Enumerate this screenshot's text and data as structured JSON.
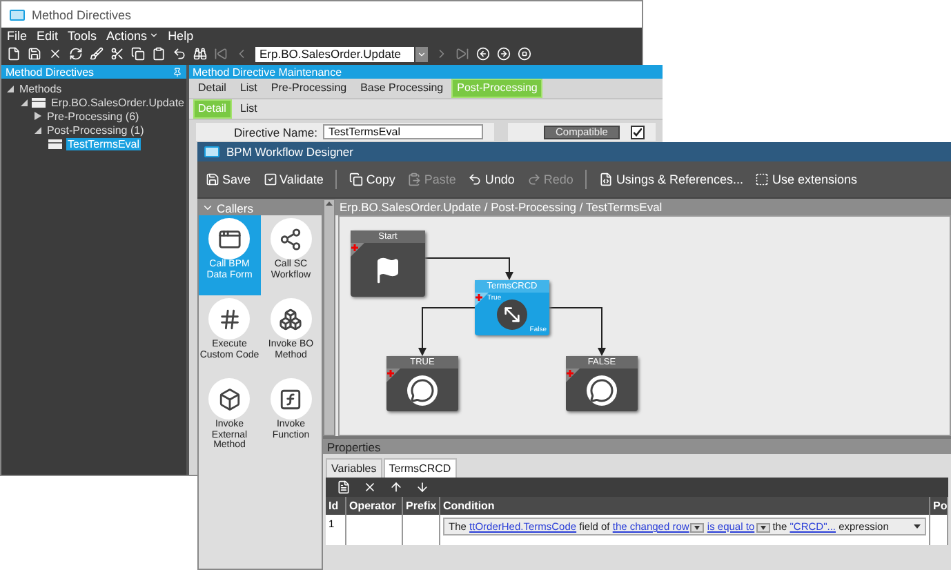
{
  "back_window": {
    "title": "Method Directives",
    "menu": [
      {
        "label": "File",
        "dropdown": false
      },
      {
        "label": "Edit",
        "dropdown": false
      },
      {
        "label": "Tools",
        "dropdown": false
      },
      {
        "label": "Actions",
        "dropdown": true
      },
      {
        "label": "Help",
        "dropdown": false
      }
    ],
    "combo_value": "Erp.BO.SalesOrder.Update",
    "left_panel": {
      "title": "Method Directives",
      "tree": [
        {
          "label": "Methods",
          "expanded": true,
          "selected": false,
          "children": [
            {
              "label": "Erp.BO.SalesOrder.Update",
              "kind": "method",
              "expanded": true,
              "selected": false,
              "children": [
                {
                  "label": "Pre-Processing (6)",
                  "expanded": false,
                  "selected": false
                },
                {
                  "label": "Post-Processing (1)",
                  "expanded": true,
                  "selected": false,
                  "children": [
                    {
                      "label": "TestTermsEval",
                      "kind": "directive",
                      "selected": true
                    }
                  ]
                }
              ]
            }
          ]
        }
      ]
    },
    "main_panel": {
      "title": "Method Directive Maintenance",
      "tabs": [
        {
          "label": "Detail",
          "selected": false
        },
        {
          "label": "List",
          "selected": false
        },
        {
          "label": "Pre-Processing",
          "selected": false
        },
        {
          "label": "Base Processing",
          "selected": false
        },
        {
          "label": "Post-Processing",
          "selected": true
        }
      ],
      "subtabs": [
        {
          "label": "Detail",
          "selected": true
        },
        {
          "label": "List",
          "selected": false
        }
      ],
      "directive_name_label": "Directive Name:",
      "directive_name": "TestTermsEval",
      "compatible_button": "Compatible",
      "compatible_checked": true
    }
  },
  "front_window": {
    "title": "BPM Workflow Designer",
    "toolbar": [
      {
        "label": "Save",
        "disabled": false
      },
      {
        "label": "Validate",
        "disabled": false
      },
      {
        "label": "Copy",
        "disabled": false
      },
      {
        "label": "Paste",
        "disabled": true
      },
      {
        "label": "Undo",
        "disabled": false
      },
      {
        "label": "Redo",
        "disabled": true
      },
      {
        "label": "Usings & References...",
        "disabled": false
      },
      {
        "label": "Use extensions",
        "disabled": false
      }
    ],
    "palette": {
      "title": "Callers",
      "items": [
        {
          "label": "Call BPM Data Form",
          "selected": true
        },
        {
          "label": "Call SC Workflow",
          "selected": false
        },
        {
          "label": "Execute Custom Code",
          "selected": false
        },
        {
          "label": "Invoke BO Method",
          "selected": false
        },
        {
          "label": "Invoke External Method",
          "selected": false
        },
        {
          "label": "Invoke Function",
          "selected": false
        }
      ]
    },
    "breadcrumb": "Erp.BO.SalesOrder.Update / Post-Processing / TestTermsEval",
    "nodes": [
      {
        "kind": "start",
        "title": "Start",
        "selected": false
      },
      {
        "kind": "condition",
        "title": "TermsCRCD",
        "selected": true,
        "true_label": "True",
        "false_label": "False"
      },
      {
        "kind": "message",
        "title": "TRUE",
        "selected": false
      },
      {
        "kind": "message",
        "title": "FALSE",
        "selected": false
      }
    ],
    "properties": {
      "title": "Properties",
      "tabs": [
        {
          "label": "Variables",
          "selected": false
        },
        {
          "label": "TermsCRCD",
          "selected": true
        }
      ],
      "columns": [
        "Id",
        "Operator",
        "Prefix",
        "Condition",
        "Po"
      ],
      "rows": [
        {
          "id": "1",
          "condition": [
            {
              "kind": "text",
              "text": "The"
            },
            {
              "kind": "link",
              "text": "ttOrderHed.TermsCode",
              "dropdown": false
            },
            {
              "kind": "text",
              "text": "field of"
            },
            {
              "kind": "link",
              "text": "the changed row",
              "dropdown": true
            },
            {
              "kind": "link",
              "text": "is equal to",
              "dropdown": true
            },
            {
              "kind": "text",
              "text": "the"
            },
            {
              "kind": "link",
              "text": "\"CRCD\"...",
              "dropdown": false
            },
            {
              "kind": "text",
              "text": "expression"
            }
          ]
        }
      ]
    }
  }
}
